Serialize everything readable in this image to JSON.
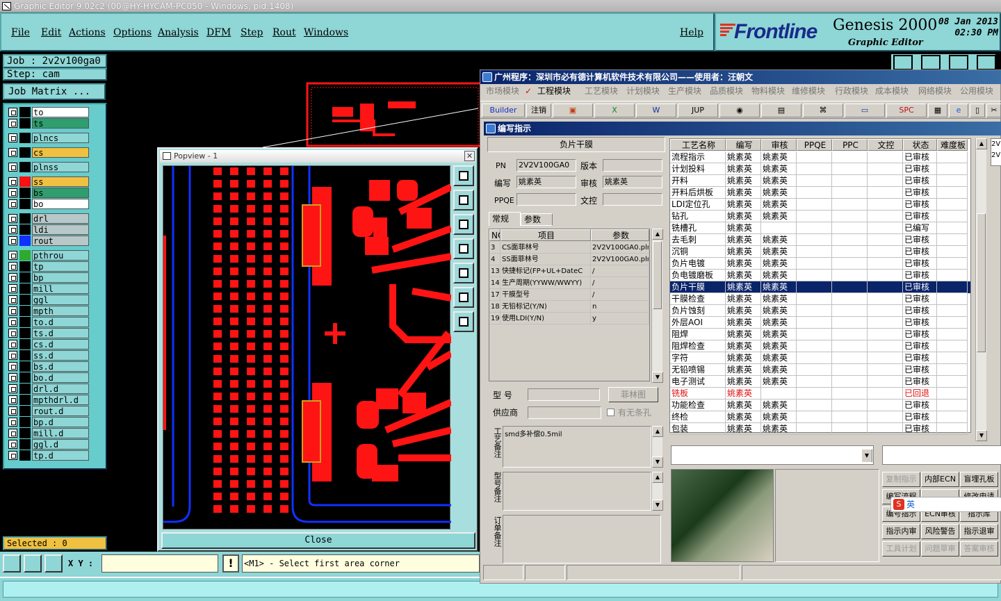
{
  "title_bar": {
    "text": "Graphic Editor 9.02c2 (00@HY-HYCAM-PC050 - Windows, pid:1408)"
  },
  "menu": [
    "File",
    "Edit",
    "Actions",
    "Options",
    "Analysis",
    "DFM",
    "Step",
    "Rout",
    "Windows"
  ],
  "menu_help": "Help",
  "brand": {
    "logo": "Frontline",
    "product": "Genesis 2000",
    "subtitle": "Graphic Editor",
    "date": "08 Jan 2013",
    "time": "02:30 PM"
  },
  "job": {
    "job_label": "Job : 2v2v100ga0",
    "step_label": "Step: cam",
    "matrix_button": "Job Matrix ..."
  },
  "layers": [
    {
      "name": "to",
      "color": "#ffffff",
      "swatch": "#000000"
    },
    {
      "name": "ts",
      "color": "#2e9e6e",
      "swatch": "#000000"
    },
    {
      "name": "plncs",
      "color": "#8fd6d6",
      "swatch": "#000000"
    },
    {
      "name": "cs",
      "color": "#f0c040",
      "swatch": "#000000"
    },
    {
      "name": "plnss",
      "color": "#8fd6d6",
      "swatch": "#000000"
    },
    {
      "name": "ss",
      "color": "#f0c040",
      "swatch": "#ff1010"
    },
    {
      "name": "bs",
      "color": "#2e9e6e",
      "swatch": "#000000"
    },
    {
      "name": "bo",
      "color": "#ffffff",
      "swatch": "#000000"
    },
    {
      "name": "drl",
      "color": "#b8c8c8",
      "swatch": "#000000"
    },
    {
      "name": "ldi",
      "color": "#b8c8c8",
      "swatch": "#000000"
    },
    {
      "name": "rout",
      "color": "#b8c8c8",
      "swatch": "#1030ff"
    },
    {
      "name": "pthrou",
      "color": "#8fd6d6",
      "swatch": "#2eaa2e"
    },
    {
      "name": "tp",
      "color": "#8fd6d6",
      "swatch": "#000000"
    },
    {
      "name": "bp",
      "color": "#8fd6d6",
      "swatch": "#000000"
    },
    {
      "name": "mill",
      "color": "#8fd6d6",
      "swatch": "#000000"
    },
    {
      "name": "ggl",
      "color": "#8fd6d6",
      "swatch": "#000000"
    },
    {
      "name": "mpth",
      "color": "#8fd6d6",
      "swatch": "#000000"
    },
    {
      "name": "to.d",
      "color": "#8fd6d6",
      "swatch": "#000000"
    },
    {
      "name": "ts.d",
      "color": "#8fd6d6",
      "swatch": "#000000"
    },
    {
      "name": "cs.d",
      "color": "#8fd6d6",
      "swatch": "#000000"
    },
    {
      "name": "ss.d",
      "color": "#8fd6d6",
      "swatch": "#000000"
    },
    {
      "name": "bs.d",
      "color": "#8fd6d6",
      "swatch": "#000000"
    },
    {
      "name": "bo.d",
      "color": "#8fd6d6",
      "swatch": "#000000"
    },
    {
      "name": "drl.d",
      "color": "#8fd6d6",
      "swatch": "#000000"
    },
    {
      "name": "mpthdrl.d",
      "color": "#8fd6d6",
      "swatch": "#000000"
    },
    {
      "name": "rout.d",
      "color": "#8fd6d6",
      "swatch": "#000000"
    },
    {
      "name": "bp.d",
      "color": "#8fd6d6",
      "swatch": "#000000"
    },
    {
      "name": "mill.d",
      "color": "#8fd6d6",
      "swatch": "#000000"
    },
    {
      "name": "ggl.d",
      "color": "#8fd6d6",
      "swatch": "#000000"
    },
    {
      "name": "tp.d",
      "color": "#8fd6d6",
      "swatch": "#000000"
    }
  ],
  "selected": "Selected : 0",
  "popview": {
    "title": "Popview - 1",
    "close": "Close"
  },
  "bottom": {
    "xy_label": "X Y :",
    "prompt": "<M1> - Select first area corner"
  },
  "cn": {
    "title": "广州程序：深圳市必有德计算机软件技术有限公司——使用者：汪朝文",
    "modules": [
      "市场模块",
      "工程模块",
      "工艺模块",
      "计划模块",
      "生产模块",
      "品质模块",
      "物料模块",
      "维修模块",
      "行政模块",
      "成本模块",
      "网络模块",
      "公用模块"
    ],
    "toolbar": [
      "Builder",
      "注销",
      "JUP",
      "SPC"
    ],
    "sub_title": "编写指示",
    "section": "负片干膜",
    "pn_label": "PN",
    "pn_value": "2V2V100GA0",
    "ver_label": "版本",
    "writer_label": "编写",
    "writer_value": "姚素英",
    "reviewer_label": "审核",
    "reviewer_value": "姚素英",
    "ppqe_label": "PPQE",
    "doc_label": "文控",
    "tabs": [
      "常规",
      "参数"
    ],
    "param_headers": [
      "NO",
      "项目",
      "参数"
    ],
    "params": [
      [
        "3",
        "CS面菲林号",
        "2V2V100GA0.plr"
      ],
      [
        "4",
        "SS面菲林号",
        "2V2V100GA0.plr"
      ],
      [
        "13",
        "快捷标记(FP+UL+DateC",
        "/"
      ],
      [
        "14",
        "生产周期(YYWW/WWYY)",
        "/"
      ],
      [
        "17",
        "干膜型号",
        "/"
      ],
      [
        "18",
        "无铅标记(Y/N)",
        "n"
      ],
      [
        "19",
        "使用LDI(Y/N)",
        "y"
      ]
    ],
    "model_label": "型 号",
    "film_button": "菲林图",
    "supplier_label": "供应商",
    "no_hole_label": "有无条孔",
    "process_note_label": "工艺备注",
    "process_note": "smd多补偿0.5mil",
    "model_note_label": "型号备注",
    "order_note_label": "订单备注",
    "proc_headers": [
      "工艺名称",
      "编写",
      "审核",
      "PPQE",
      "PPC",
      "文控",
      "状态",
      "难度板"
    ],
    "procs": [
      [
        "流程指示",
        "姚素英",
        "姚素英",
        "已审核"
      ],
      [
        "计划投料",
        "姚素英",
        "姚素英",
        "已审核"
      ],
      [
        "开料",
        "姚素英",
        "姚素英",
        "已审核"
      ],
      [
        "开料后烘板",
        "姚素英",
        "姚素英",
        "已审核"
      ],
      [
        "LDI定位孔",
        "姚素英",
        "姚素英",
        "已审核"
      ],
      [
        "钻孔",
        "姚素英",
        "姚素英",
        "已审核"
      ],
      [
        "铣槽孔",
        "姚素英",
        "",
        "已编写"
      ],
      [
        "去毛刺",
        "姚素英",
        "姚素英",
        "已审核"
      ],
      [
        "沉铜",
        "姚素英",
        "姚素英",
        "已审核"
      ],
      [
        "负片电镀",
        "姚素英",
        "姚素英",
        "已审核"
      ],
      [
        "负电镀磨板",
        "姚素英",
        "姚素英",
        "已审核"
      ],
      [
        "负片干膜",
        "姚素英",
        "姚素英",
        "已审核"
      ],
      [
        "干膜检查",
        "姚素英",
        "姚素英",
        "已审核"
      ],
      [
        "负片蚀刻",
        "姚素英",
        "姚素英",
        "已审核"
      ],
      [
        "外层AOI",
        "姚素英",
        "姚素英",
        "已审核"
      ],
      [
        "阻焊",
        "姚素英",
        "姚素英",
        "已审核"
      ],
      [
        "阻焊检查",
        "姚素英",
        "姚素英",
        "已审核"
      ],
      [
        "字符",
        "姚素英",
        "姚素英",
        "已审核"
      ],
      [
        "无铅喷锡",
        "姚素英",
        "姚素英",
        "已审核"
      ],
      [
        "电子测试",
        "姚素英",
        "姚素英",
        "已审核"
      ],
      [
        "铣板",
        "姚素英",
        "",
        "已回退"
      ],
      [
        "功能检查",
        "姚素英",
        "姚素英",
        "已审核"
      ],
      [
        "终检",
        "姚素英",
        "姚素英",
        "已审核"
      ],
      [
        "包装",
        "姚素英",
        "姚素英",
        "已审核"
      ]
    ],
    "right_list": [
      "2V",
      "2V"
    ],
    "buttons": [
      [
        "复制指示",
        "内部ECN",
        "盲埋孔板"
      ],
      [
        "编写流程",
        "",
        "修改申请"
      ],
      [
        "编号指示",
        "ECN审核",
        "指示库"
      ],
      [
        "指示内审",
        "风险警告",
        "指示退审"
      ],
      [
        "工具计划",
        "问题草审",
        "答案审核"
      ]
    ],
    "ime": "英"
  },
  "colors": {
    "cyan": "#8fd6d6",
    "copper": "#ff1414",
    "outline": "#1030ff",
    "highlight": "#0a246a"
  }
}
